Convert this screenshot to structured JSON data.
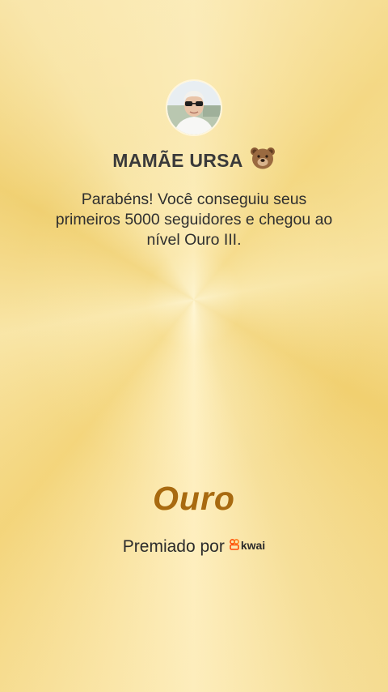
{
  "profile": {
    "username": "MAMÃE URSA",
    "emoji": "bear-face-icon",
    "avatar": "avatar"
  },
  "message": {
    "text": "Parabéns! Você conseguiu seus primeiros 5000 seguidores e chegou ao nível Ouro III."
  },
  "level": {
    "name": "Ouro"
  },
  "award": {
    "prefix": "Premiado por",
    "brand": "kwai",
    "brand_icon": "kwai-logo-icon"
  },
  "colors": {
    "background": "#f5dc8e",
    "level_text": "#a86a10",
    "brand_accent": "#ff4906"
  }
}
